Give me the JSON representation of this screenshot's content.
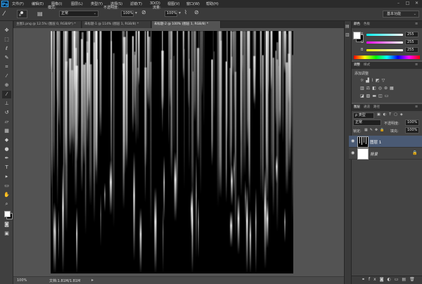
{
  "menubar": {
    "logo": "Ps",
    "items": [
      "文件(F)",
      "编辑(E)",
      "图像(I)",
      "图层(L)",
      "类型(Y)",
      "选择(S)",
      "滤镜(T)",
      "3D(D)",
      "视图(V)",
      "窗口(W)",
      "帮助(H)"
    ]
  },
  "options": {
    "brush_size": "8",
    "mode_label": "模式:",
    "mode_value": "正常",
    "opacity_label": "不透明度:",
    "opacity_value": "100%",
    "flow_label": "流量:",
    "flow_value": "100%"
  },
  "workspace": "基本功能",
  "tabs": [
    {
      "label": "主图1.png @ 12.5% (图层 0, RGB/8*) *"
    },
    {
      "label": "未标题-1 @ 114% (图层 1, RGB/8) *"
    },
    {
      "label": "未标题-2 @ 100% (图层 1, RGB/8) *"
    }
  ],
  "status": {
    "zoom": "100%",
    "doc": "文档:1.81M/1.81M"
  },
  "color_panel": {
    "tabs": [
      "颜色",
      "色板"
    ],
    "channels": [
      {
        "label": "R",
        "value": "255"
      },
      {
        "label": "G",
        "value": "255"
      },
      {
        "label": "B",
        "value": "255"
      }
    ]
  },
  "adjust_panel": {
    "tabs": [
      "调整",
      "样式"
    ],
    "title": "添加调整"
  },
  "layers_panel": {
    "tabs": [
      "图层",
      "通道",
      "路径"
    ],
    "filter": "ρ 类型",
    "blend": "正常",
    "opacity_label": "不透明度:",
    "opacity_value": "100%",
    "lock_label": "锁定:",
    "fill_label": "填充:",
    "fill_value": "100%",
    "layers": [
      {
        "name": "图层 1"
      },
      {
        "name": "背景"
      }
    ]
  },
  "colors": {
    "canvas": "#000000",
    "selected_layer": "#4a5a74",
    "accent_blue": "#31a8ff"
  }
}
